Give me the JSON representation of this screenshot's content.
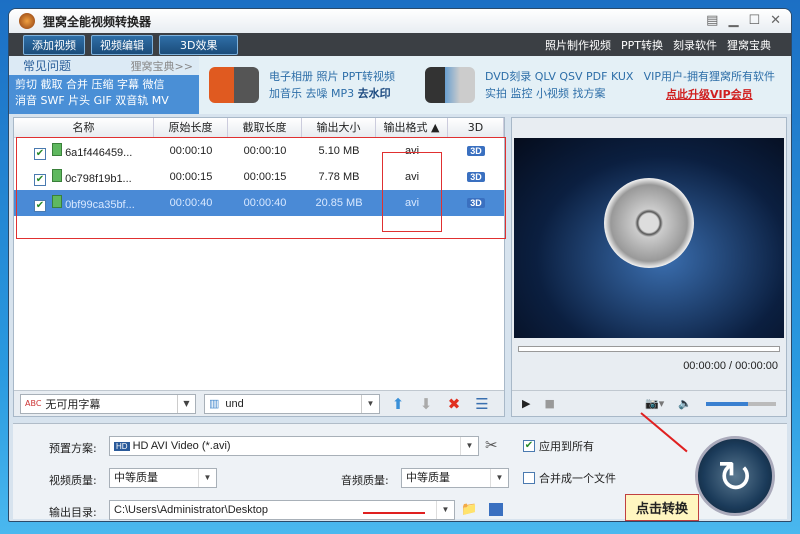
{
  "window": {
    "title": "狸窝全能视频转换器"
  },
  "toolbar": {
    "buttons": [
      "添加视频",
      "视频编辑",
      "3D效果"
    ],
    "links": [
      "照片制作视频",
      "PPT转换",
      "刻录软件",
      "狸窝宝典"
    ]
  },
  "banner": {
    "faq_title": "常见问题",
    "faq_more": "狸窝宝典>>",
    "faq_line1": "剪切 截取 合并 压缩 字幕 微信",
    "faq_line2": "消音 SWF 片头 GIF 双音轨 MV",
    "group1_line1": "电子相册 照片 PPT转视频",
    "group1_line2a": "加音乐 去噪 MP3 ",
    "group1_line2b": "去水印",
    "group2_line1": "DVD刻录 QLV QSV PDF KUX",
    "group2_line2": "实拍 监控 小视频 找方案",
    "vip_text": "VIP用户-拥有狸窝所有软件",
    "vip_link": "点此升级VIP会员"
  },
  "table": {
    "columns": [
      "名称",
      "原始长度",
      "截取长度",
      "输出大小",
      "输出格式 ▲",
      "3D"
    ],
    "rows": [
      {
        "name": "6a1f446459...",
        "orig": "00:00:10",
        "clip": "00:00:10",
        "size": "5.10 MB",
        "format": "avi",
        "checked": true
      },
      {
        "name": "0c798f19b1...",
        "orig": "00:00:15",
        "clip": "00:00:15",
        "size": "7.78 MB",
        "format": "avi",
        "checked": true
      },
      {
        "name": "0bf99ca35bf...",
        "orig": "00:00:40",
        "clip": "00:00:40",
        "size": "20.85 MB",
        "format": "avi",
        "checked": true,
        "selected": true
      }
    ],
    "badge_3d": "3D"
  },
  "listbar": {
    "subtitle": "无可用字幕",
    "audio": "und"
  },
  "player": {
    "time": "00:00:00 / 00:00:00",
    "volume": 0.6,
    "progress": 0
  },
  "settings": {
    "preset_label": "预置方案:",
    "preset_value": "HD AVI Video (*.avi)",
    "apply_all": "应用到所有",
    "apply_all_checked": true,
    "video_quality_label": "视频质量:",
    "video_quality": "中等质量",
    "audio_quality_label": "音频质量:",
    "audio_quality": "中等质量",
    "merge": "合并成一个文件",
    "merge_checked": false,
    "output_label": "输出目录:",
    "output_dir": "C:\\Users\\Administrator\\Desktop"
  },
  "convert": {
    "tip": "点击转换"
  },
  "colors": {
    "accent": "#4a8ad6",
    "annotation": "#e03030"
  }
}
